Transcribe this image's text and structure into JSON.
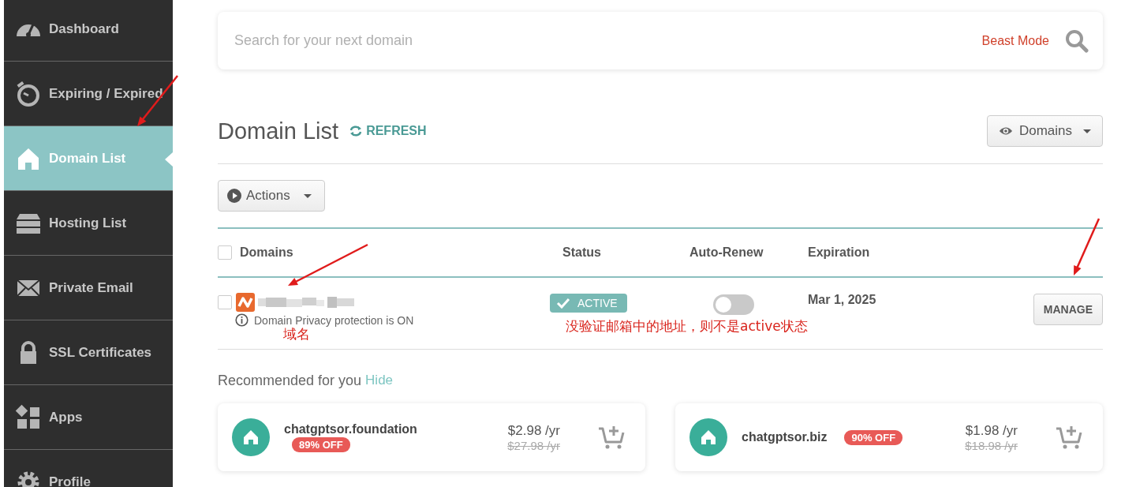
{
  "sidebar": {
    "items": [
      {
        "label": "Dashboard",
        "kind": "gauge",
        "selected": false
      },
      {
        "label": "Expiring / Expired",
        "kind": "timer",
        "selected": false
      },
      {
        "label": "Domain List",
        "kind": "house",
        "selected": true
      },
      {
        "label": "Hosting List",
        "kind": "server",
        "selected": false
      },
      {
        "label": "Private Email",
        "kind": "mail",
        "selected": false
      },
      {
        "label": "SSL Certificates",
        "kind": "lock",
        "selected": false
      },
      {
        "label": "Apps",
        "kind": "apps",
        "selected": false
      },
      {
        "label": "Profile",
        "kind": "gear",
        "selected": false
      }
    ]
  },
  "search": {
    "placeholder": "Search for your next domain",
    "mode_link": "Beast Mode"
  },
  "header": {
    "title": "Domain List",
    "refresh": "REFRESH",
    "view_menu": "Domains"
  },
  "actions_menu": "Actions",
  "table": {
    "columns": [
      "Domains",
      "Status",
      "Auto-Renew",
      "Expiration"
    ],
    "select_all_checked": false,
    "rows": [
      {
        "checked": false,
        "privacy": "Domain Privacy protection is ON",
        "status": "ACTIVE",
        "auto_renew": false,
        "expiration": "Mar 1, 2025",
        "action": "MANAGE"
      }
    ]
  },
  "domain_note": "域名",
  "status_note": "没验证邮箱中的地址，则不是active状态",
  "recommended": {
    "title": "Recommended for you",
    "hide": "Hide",
    "items": [
      {
        "domain": "chatgptsor.foundation",
        "discount": "89% OFF",
        "price": "$2.98 /yr",
        "old_price": "$27.98 /yr"
      },
      {
        "domain": "chatgptsor.biz",
        "discount": "90% OFF",
        "price": "$1.98 /yr",
        "old_price": "$18.98 /yr"
      }
    ]
  }
}
